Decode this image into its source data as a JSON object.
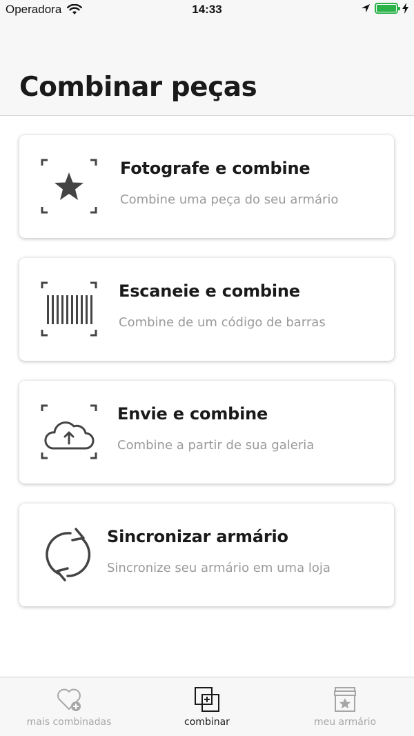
{
  "status_bar": {
    "carrier": "Operadora",
    "time": "14:33",
    "wifi_icon": "wifi-icon",
    "location_icon": "location-arrow-icon",
    "battery_icon": "battery-icon",
    "charging_icon": "charging-bolt-icon",
    "battery_color": "#2bb34a"
  },
  "header": {
    "title": "Combinar peças"
  },
  "options": [
    {
      "title": "Fotografe e combine",
      "subtitle": "Combine uma peça do seu armário",
      "icon": "camera-frame-star-icon"
    },
    {
      "title": "Escaneie e combine",
      "subtitle": "Combine de um código de barras",
      "icon": "barcode-scan-icon"
    },
    {
      "title": "Envie e combine",
      "subtitle": "Combine a partir de sua galeria",
      "icon": "cloud-upload-icon"
    },
    {
      "title": "Sincronizar armário",
      "subtitle": "Sincronize seu armário em uma loja",
      "icon": "sync-icon"
    }
  ],
  "tab_bar": {
    "tabs": [
      {
        "label": "mais combinadas",
        "icon": "heart-plus-icon",
        "active": false
      },
      {
        "label": "combinar",
        "icon": "combine-squares-icon",
        "active": true
      },
      {
        "label": "meu armário",
        "icon": "wardrobe-star-icon",
        "active": false
      }
    ]
  },
  "colors": {
    "title_text": "#1a1a1a",
    "subtitle_text": "#9a9a9a",
    "icon_gray": "#444444",
    "inactive_tab": "#a6a6a6"
  }
}
